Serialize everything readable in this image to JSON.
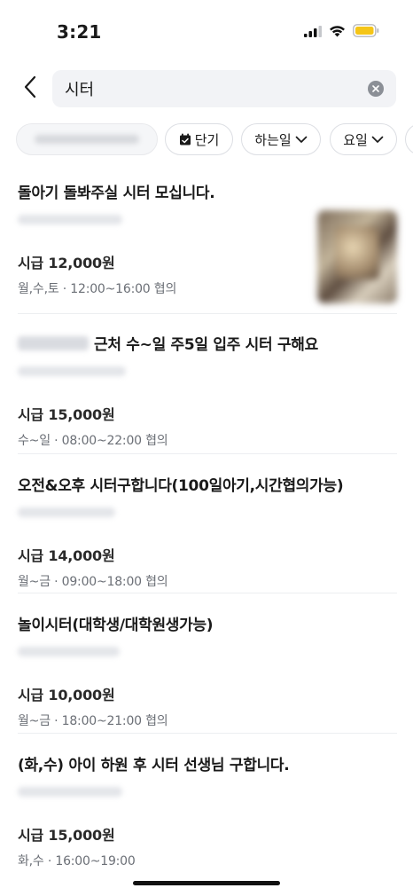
{
  "status_bar": {
    "time": "3:21",
    "icons": [
      "signal-icon",
      "wifi-icon",
      "battery-icon"
    ],
    "battery_color": "#f5c518"
  },
  "search": {
    "value": "시터",
    "placeholder": "",
    "back_icon": "chevron-left-icon",
    "clear_icon": "clear-icon"
  },
  "filters": {
    "short_term_label": "단기",
    "short_term_icon": "calendar-icon",
    "task_label": "하는일",
    "day_label": "요일"
  },
  "listings": [
    {
      "title": "돌아기 돌봐주실 시터 모십니다.",
      "wage": "시급 12,000원",
      "schedule": "월,수,토 · 12:00~16:00 협의",
      "has_thumbnail": true
    },
    {
      "title": "근처 수~일 주5일 입주 시터 구해요",
      "wage": "시급 15,000원",
      "schedule": "수~일 · 08:00~22:00 협의",
      "blurred_prefix": true
    },
    {
      "title": "오전&오후 시터구합니다(100일아기,시간협의가능)",
      "wage": "시급 14,000원",
      "schedule": "월~금 · 09:00~18:00 협의"
    },
    {
      "title": "놀이시터(대학생/대학원생가능)",
      "wage": "시급 10,000원",
      "schedule": "월~금 · 18:00~21:00 협의"
    },
    {
      "title": "(화,수) 아이 하원 후 시터 선생님 구합니다.",
      "wage": "시급 15,000원",
      "schedule": "화,수 · 16:00~19:00"
    }
  ],
  "colors": {
    "accent_text": "#1a1a1a",
    "secondary_text": "#6b6f76",
    "search_bg": "#f2f3f6"
  }
}
